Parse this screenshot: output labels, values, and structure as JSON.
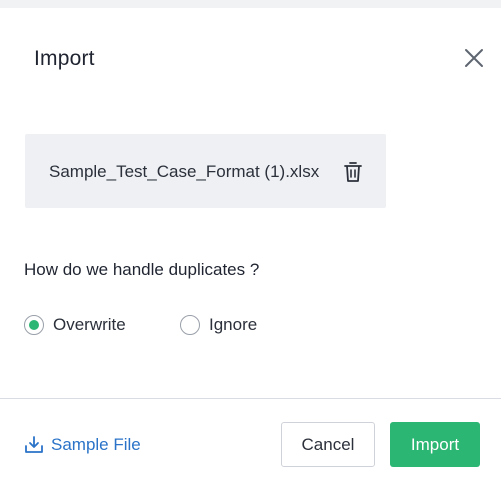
{
  "modal": {
    "title": "Import",
    "close_icon": "close-icon"
  },
  "file": {
    "name": "Sample_Test_Case_Format (1).xlsx",
    "remove_icon": "trash-icon"
  },
  "duplicates": {
    "question": "How do we handle duplicates ?",
    "options": [
      {
        "label": "Overwrite",
        "selected": true
      },
      {
        "label": "Ignore",
        "selected": false
      }
    ]
  },
  "footer": {
    "sample_link_label": "Sample File",
    "sample_link_icon": "download-icon",
    "cancel_label": "Cancel",
    "import_label": "Import"
  },
  "colors": {
    "accent_green": "#2bb673",
    "link_blue": "#2a73c8",
    "file_box_bg": "#eef0f4"
  }
}
